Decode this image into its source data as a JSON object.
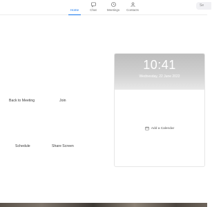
{
  "nav": {
    "home": "Home",
    "chat": "Chat",
    "meetings": "Meetings",
    "contacts": "Contacts"
  },
  "search": {
    "label": "Se"
  },
  "actions": {
    "back_to_meeting": "Back to Meeting",
    "join": "Join",
    "schedule": "Schedule",
    "share_screen": "Share Screen"
  },
  "calendar_card": {
    "time": "10:41",
    "date": "Wednesday, 22 June 2022",
    "add_calendar": "Add a Calendar"
  },
  "colors": {
    "accent": "#0e72ed",
    "text": "#3a3a3a",
    "card_header": "#c8c8c8"
  },
  "icons": {
    "chat": "chat-bubble-icon",
    "meetings": "clock-icon",
    "contacts": "person-icon",
    "add_calendar": "calendar-icon"
  }
}
